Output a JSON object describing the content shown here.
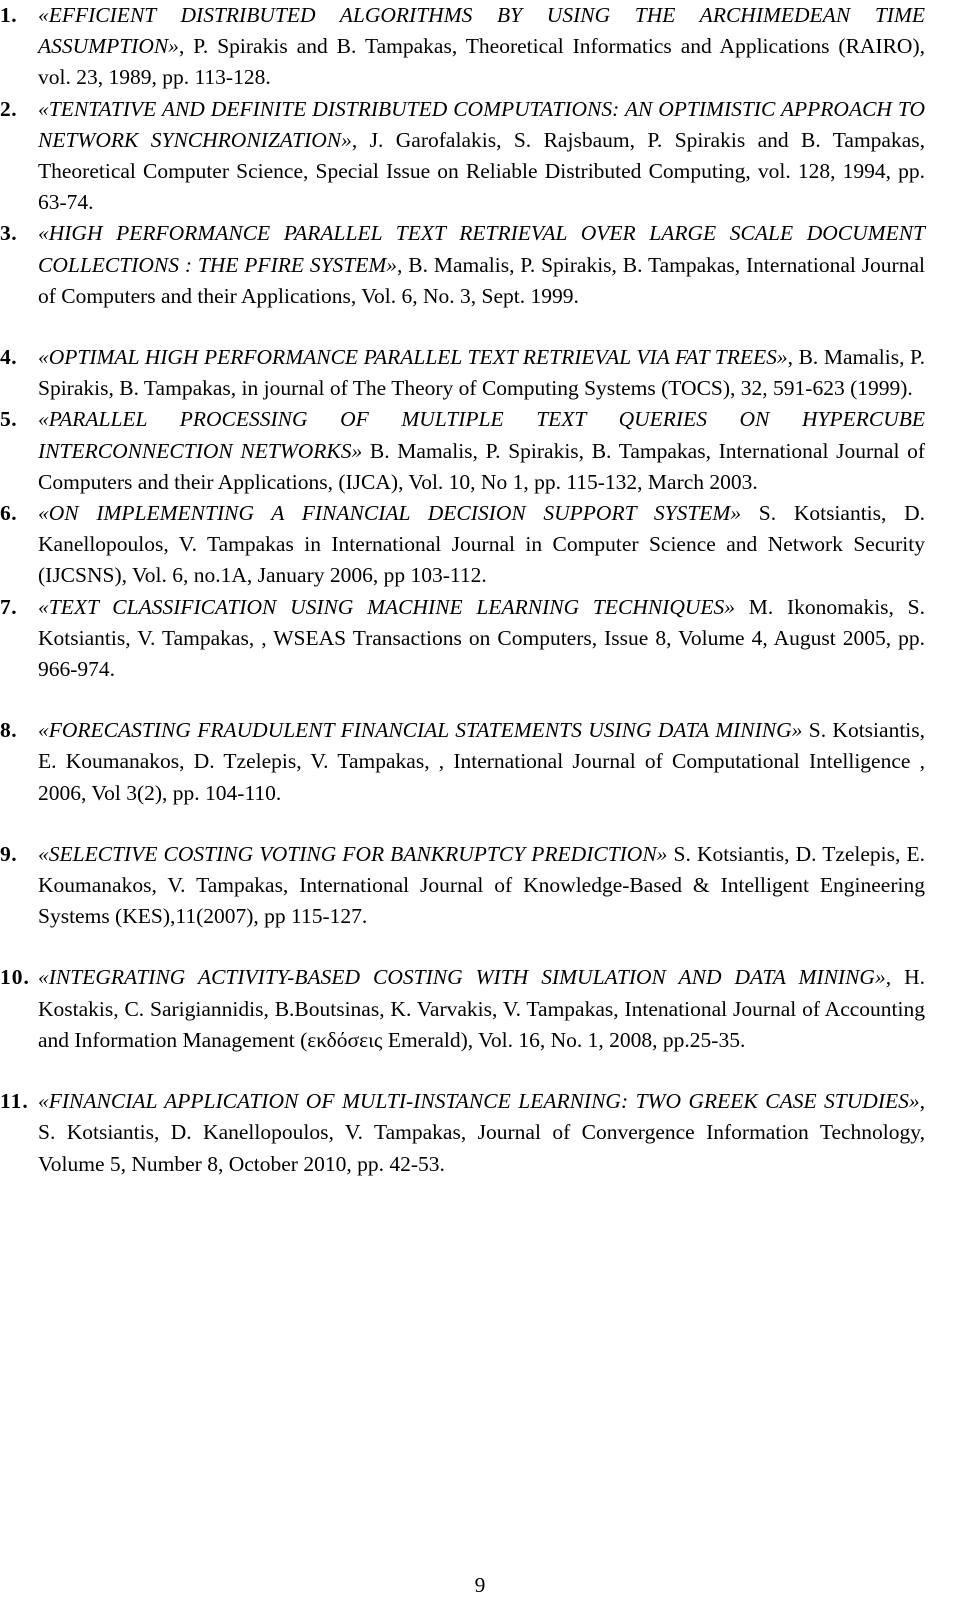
{
  "document": {
    "page_number": "9",
    "references": [
      {
        "number": "1.",
        "title": "«EFFICIENT DISTRIBUTED ALGORITHMS BY USING THE ARCHIMEDEAN TIME ASSUMPTION»",
        "rest": ", P. Spirakis and B. Tampakas, Theoretical Informatics and Applications (RAIRO), vol. 23, 1989, pp. 113-128.",
        "gap_before": false
      },
      {
        "number": "2.",
        "title": "«TENTATIVE AND DEFINITE DISTRIBUTED COMPUTATIONS: AN OPTIMISTIC APPROACH TO NETWORK SYNCHRONIZATION»",
        "rest": ", J. Garofalakis, S. Rajsbaum, P. Spirakis and B. Tampakas, Theoretical Computer Science, Special Issue on Reliable Distributed Computing, vol. 128, 1994, pp. 63-74.",
        "gap_before": false
      },
      {
        "number": "3.",
        "title": "«HIGH PERFORMANCE PARALLEL TEXT RETRIEVAL OVER LARGE SCALE DOCUMENT COLLECTIONS : THE PFIRE SYSTEM»",
        "rest": ", B. Mamalis, P. Spirakis, B. Tampakas, International Journal of Computers and their Applications, Vol. 6, No. 3, Sept. 1999.",
        "gap_before": false
      },
      {
        "number": "4.",
        "title": "«OPTIMAL HIGH PERFORMANCE PARALLEL TEXT RETRIEVAL VIA FAT TREES»",
        "rest": ", B. Mamalis, P. Spirakis, B. Tampakas, in journal of The Theory of Computing Systems (TOCS), 32, 591-623 (1999).",
        "gap_before": true
      },
      {
        "number": "5.",
        "title": "«PARALLEL PROCESSING OF MULTIPLE TEXT QUERIES ON HYPERCUBE INTERCONNECTION NETWORKS»",
        "rest": " B. Mamalis, P. Spirakis, B. Tampakas, International Journal of Computers and their Applications, (IJCA), Vol. 10, No 1, pp. 115-132, March 2003.",
        "gap_before": false
      },
      {
        "number": "6.",
        "title": "«ON IMPLEMENTING A FINANCIAL DECISION SUPPORT SYSTEM»",
        "rest": " S. Kotsiantis, D. Kanellopoulos, V. Tampakas in International Journal in Computer Science and Network Security (IJCSNS), Vol. 6, no.1A, January 2006, pp 103-112.",
        "gap_before": false
      },
      {
        "number": "7.",
        "title": "«TEXT CLASSIFICATION USING MACHINE LEARNING TECHNIQUES»",
        "rest": " M. Ikonomakis, S. Kotsiantis, V. Tampakas, , WSEAS Transactions on Computers, Issue 8, Volume 4, August 2005, pp. 966-974.",
        "gap_before": false
      },
      {
        "number": "8.",
        "title": "«FORECASTING FRAUDULENT FINANCIAL STATEMENTS USING DATA MINING»",
        "rest": " S. Kotsiantis, E. Koumanakos, D. Tzelepis, V. Tampakas, , International Journal of Computational Intelligence , 2006, Vol 3(2), pp. 104-110.",
        "gap_before": true
      },
      {
        "number": "9.",
        "title": "«SELECTIVE COSTING VOTING FOR BANKRUPTCY PREDICTION»",
        "rest": " S. Kotsiantis, D. Tzelepis, E. Koumanakos, V. Tampakas, International Journal of Knowledge-Based & Intelligent Engineering Systems (KES),11(2007), pp 115-127.",
        "gap_before": true
      },
      {
        "number": "10.",
        "title": "«INTEGRATING ACTIVITY-BASED COSTING WITH SIMULATION AND DATA MINING»",
        "rest": ", H. Kostakis, C. Sarigiannidis, B.Boutsinas, K. Varvakis, V. Tampakas, Intenational Journal of Accounting and Information Management (εκδόσεις Emerald), Vol. 16, No. 1, 2008, pp.25-35.",
        "gap_before": true
      },
      {
        "number": "11.",
        "title": "«FINANCIAL APPLICATION OF MULTI-INSTANCE LEARNING: TWO GREEK CASE STUDIES»",
        "rest": ", S. Kotsiantis, D. Kanellopoulos, V. Tampakas, Journal of Convergence Information Technology, Volume 5, Number 8, October 2010, pp. 42-53.",
        "gap_before": true
      }
    ]
  }
}
